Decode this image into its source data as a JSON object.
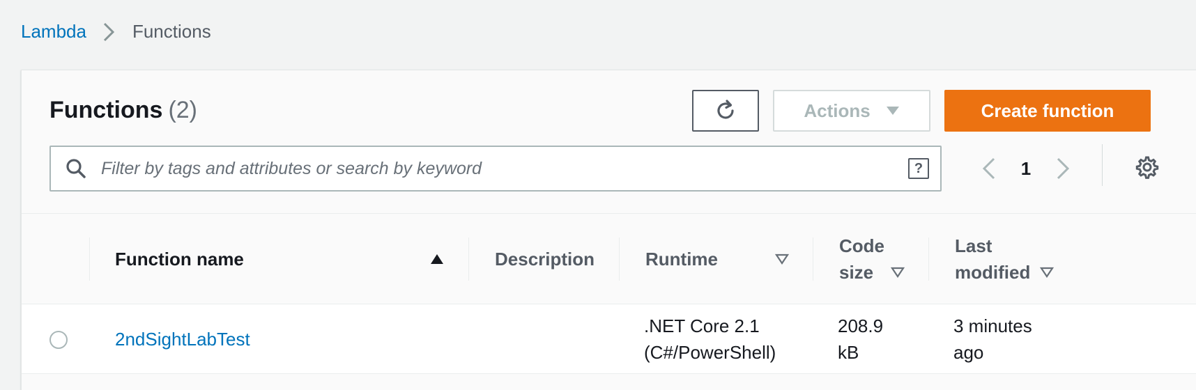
{
  "breadcrumb": {
    "root": "Lambda",
    "current": "Functions"
  },
  "header": {
    "title": "Functions",
    "count": "(2)",
    "actions_label": "Actions",
    "create_label": "Create function"
  },
  "search": {
    "placeholder": "Filter by tags and attributes or search by keyword",
    "value": ""
  },
  "pagination": {
    "page": "1"
  },
  "table": {
    "columns": {
      "name": "Function name",
      "description": "Description",
      "runtime": "Runtime",
      "code_size_1": "Code",
      "code_size_2": "size",
      "modified_1": "Last",
      "modified_2": "modified"
    },
    "rows": [
      {
        "name": "2ndSightLabTest",
        "description": "",
        "runtime_1": ".NET Core 2.1",
        "runtime_2": "(C#/PowerShell)",
        "size_1": "208.9",
        "size_2": "kB",
        "modified_1": "3 minutes",
        "modified_2": "ago"
      }
    ]
  },
  "colors": {
    "link": "#0073bb",
    "primary_button": "#ec7211",
    "background": "#f2f3f3"
  },
  "icons": [
    "chevron-right-icon",
    "refresh-icon",
    "caret-down-icon",
    "search-icon",
    "help-icon",
    "chevron-left-icon",
    "gear-icon",
    "sort-ascending-icon",
    "sort-descending-icon"
  ]
}
